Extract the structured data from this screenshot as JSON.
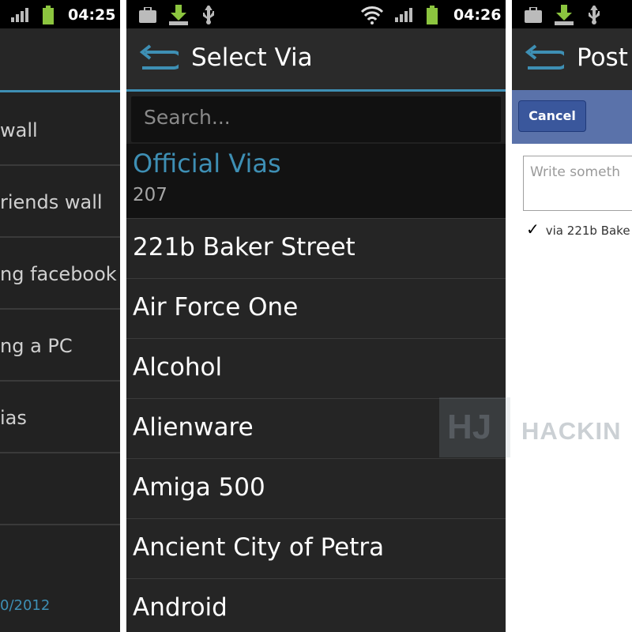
{
  "panel1": {
    "statusbar": {
      "time": "04:25"
    },
    "items": [
      "wall",
      "riends wall",
      "ng facebook",
      "ng a PC",
      "ias",
      ""
    ],
    "footer_date": "0/2012"
  },
  "panel2": {
    "statusbar": {
      "time": "04:26"
    },
    "title": "Select Via",
    "search": {
      "placeholder": "Search..."
    },
    "section": {
      "title": "Official Vias",
      "count": "207"
    },
    "items": [
      "221b Baker Street",
      "Air Force One",
      "Alcohol",
      "Alienware",
      "Amiga 500",
      "Ancient City of Petra",
      "Android"
    ]
  },
  "panel3": {
    "title": "Post",
    "cancel_label": "Cancel",
    "textarea_placeholder": "Write someth",
    "via_label": "via 221b Bake"
  },
  "watermark": {
    "box": "HJ",
    "text": "HACKIN"
  },
  "colors": {
    "accent": "#3e8fb4",
    "background": "#212121",
    "facebook_blue": "#3a579c"
  },
  "icons": [
    "signal-icon",
    "battery-icon",
    "briefcase-icon",
    "download-icon",
    "usb-icon",
    "wifi-icon",
    "back-arrow-icon",
    "checkmark-icon"
  ]
}
